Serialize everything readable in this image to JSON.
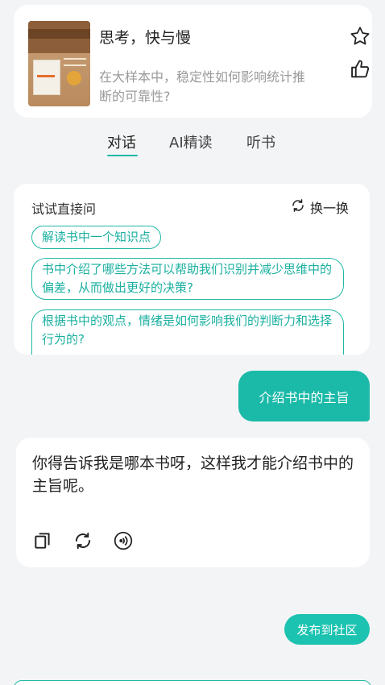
{
  "book": {
    "title": "思考，快与慢",
    "question": "在大样本中，稳定性如何影响统计推断的可靠性?"
  },
  "tabs": [
    {
      "label": "对话",
      "active": true
    },
    {
      "label": "AI精读",
      "active": false
    },
    {
      "label": "听书",
      "active": false
    }
  ],
  "suggestions": {
    "title": "试试直接问",
    "refresh_label": "换一换",
    "items": [
      "解读书中一个知识点",
      "书中介绍了哪些方法可以帮助我们识别并减少思维中的偏差，从而做出更好的决策?",
      "根据书中的观点，情绪是如何影响我们的判断力和选择行为的?"
    ]
  },
  "chat": {
    "user_message": "介绍书中的主旨",
    "ai_reply": "你得告诉我是哪本书呀，这样我才能介绍书中的主旨呢。"
  },
  "publish_label": "发布到社区",
  "colors": {
    "accent": "#1bb9a8",
    "background": "#f3f4f6",
    "card": "#ffffff",
    "muted_text": "#9a9a9a"
  },
  "icons": {
    "star": "star-icon",
    "like": "thumbs-up-icon",
    "refresh": "refresh-icon",
    "copy": "copy-icon",
    "regenerate": "regenerate-icon",
    "speak": "speaker-icon"
  }
}
